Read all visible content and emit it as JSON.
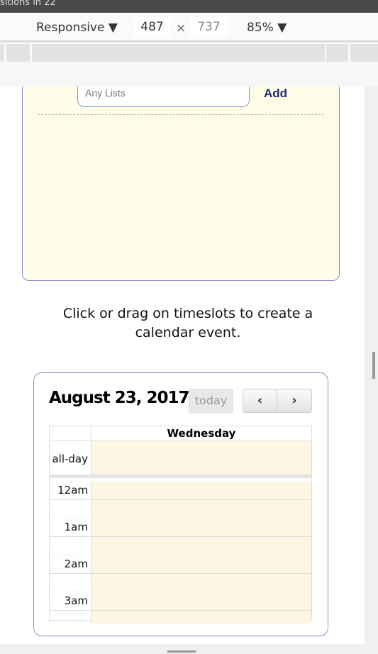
{
  "window": {
    "title": "sitions in 22"
  },
  "devtools": {
    "device": "Responsive",
    "device_arrow": "▼",
    "width": "487",
    "times": "×",
    "height": "737",
    "zoom": "85%",
    "zoom_arrow": "▼"
  },
  "lists": {
    "input_placeholder": "Any Lists",
    "add_label": "Add"
  },
  "hint": "Click or drag on timeslots to create a calendar event.",
  "calendar": {
    "title": "August 23, 2017",
    "today_label": "today",
    "prev_icon": "‹",
    "next_icon": "›",
    "day_header": "Wednesday",
    "allday_label": "all-day",
    "slots": [
      "12am",
      "",
      "1am",
      "",
      "2am",
      "",
      "3am",
      ""
    ],
    "cell_color": "#fdf6e3"
  },
  "colors": {
    "card_border": "#8a8fc8",
    "list_bg": "#fffde8",
    "add": "#1f2a78"
  }
}
